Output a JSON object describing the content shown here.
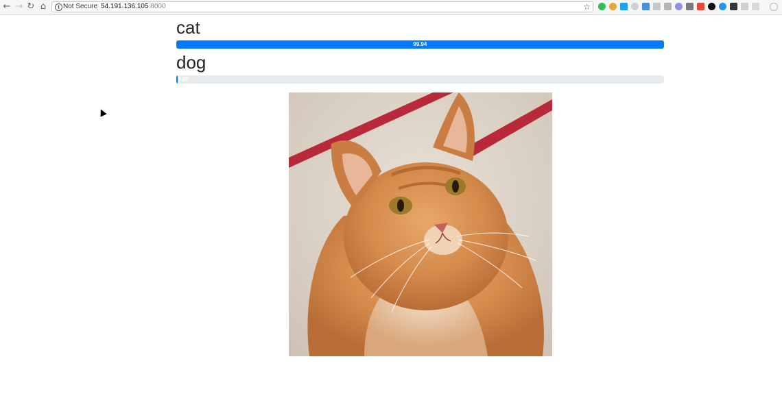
{
  "browser": {
    "security_label": "Not Secure",
    "url_host": "54.191.136.105",
    "url_port": ":8000"
  },
  "predictions": [
    {
      "label": "cat",
      "value_text": "99.94",
      "percent": 99.94
    },
    {
      "label": "dog",
      "value_text": "0.06",
      "percent": 0.06
    }
  ],
  "colors": {
    "progress_fill": "#007bff",
    "progress_track": "#e9ecef"
  },
  "image": {
    "subject": "orange tabby cat photo"
  }
}
